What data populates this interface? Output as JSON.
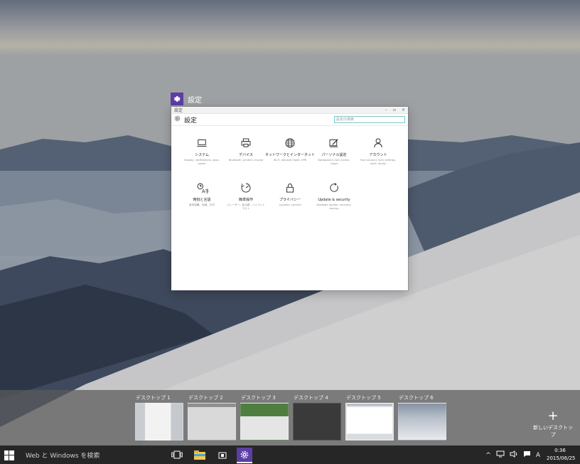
{
  "window_badge": {
    "title": "設定"
  },
  "settings": {
    "titlebar_left": "設定",
    "header_title": "設定",
    "search_placeholder": "設定の検索",
    "tiles": [
      {
        "name": "システム",
        "desc": "Display, notifications, apps, power",
        "icon": "laptop-icon"
      },
      {
        "name": "デバイス",
        "desc": "Bluetooth, printers, mouse",
        "icon": "printer-icon"
      },
      {
        "name": "ネットワークとインターネット",
        "desc": "Wi-Fi, airplane mode, VPN",
        "icon": "globe-icon"
      },
      {
        "name": "パーソナル設定",
        "desc": "Background, lock screen, colors",
        "icon": "paintbrush-icon"
      },
      {
        "name": "アカウント",
        "desc": "Your account, sync settings, work, family",
        "icon": "person-icon"
      },
      {
        "name": "時刻と言語",
        "desc": "音声認識、地域、日付",
        "icon": "time-language-icon"
      },
      {
        "name": "簡単操作",
        "desc": "ナレーター、拡大鏡、ハイコントラスト",
        "icon": "ease-of-access-icon"
      },
      {
        "name": "プライバシー",
        "desc": "Location, camera",
        "icon": "lock-icon"
      },
      {
        "name": "Update & security",
        "desc": "Windows Update, recovery, backup",
        "icon": "refresh-icon"
      }
    ]
  },
  "desktops": [
    {
      "label": "デスクトップ 1"
    },
    {
      "label": "デスクトップ 2"
    },
    {
      "label": "デスクトップ 3"
    },
    {
      "label": "デスクトップ 4"
    },
    {
      "label": "デスクトップ 5"
    },
    {
      "label": "デスクトップ 6"
    }
  ],
  "new_desktop": {
    "label": "新しいデスクトップ",
    "icon": "plus-icon"
  },
  "taskbar": {
    "search_text": "Web と Windows を検索",
    "ime": "A",
    "time": "0:36",
    "date": "2015/06/25"
  },
  "colors": {
    "accent": "#5b3fa5",
    "taskbar": "#262626"
  }
}
